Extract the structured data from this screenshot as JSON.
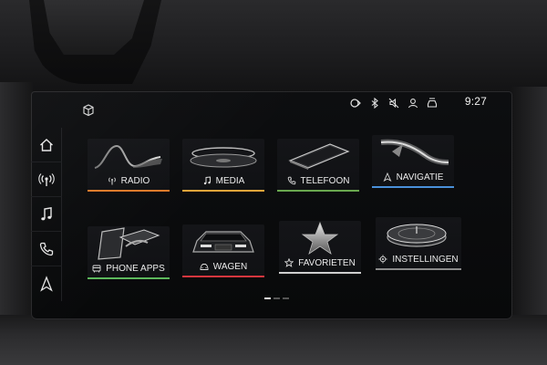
{
  "status_bar": {
    "time": "9:27",
    "icons": [
      "navigation-status-icon",
      "bluetooth-icon",
      "mute-icon",
      "user-icon",
      "car-data-icon"
    ]
  },
  "sidebar": {
    "items": [
      {
        "name": "home",
        "icon": "home-icon"
      },
      {
        "name": "radio",
        "icon": "radio-antenna-icon"
      },
      {
        "name": "media",
        "icon": "music-note-icon"
      },
      {
        "name": "phone",
        "icon": "phone-icon"
      },
      {
        "name": "navigation",
        "icon": "navigation-arrow-icon"
      }
    ]
  },
  "tiles": [
    {
      "label": "RADIO",
      "icon": "radio-antenna-icon",
      "accent": "#e07a2a"
    },
    {
      "label": "MEDIA",
      "icon": "music-note-icon",
      "accent": "#e8a53a"
    },
    {
      "label": "TELEFOON",
      "icon": "phone-icon",
      "accent": "#6aa84f"
    },
    {
      "label": "NAVIGATIE",
      "icon": "navigation-arrow-icon",
      "accent": "#4a90d9"
    },
    {
      "label": "PHONE APPS",
      "icon": "phone-apps-icon",
      "accent": "#5cb85c"
    },
    {
      "label": "WAGEN",
      "icon": "car-icon",
      "accent": "#d9363e"
    },
    {
      "label": "FAVORIETEN",
      "icon": "star-icon",
      "accent": "#cfcfcf"
    },
    {
      "label": "INSTELLINGEN",
      "icon": "gear-icon",
      "accent": "#8a8a8a"
    }
  ],
  "pagination": {
    "pages": 3,
    "active": 1
  }
}
